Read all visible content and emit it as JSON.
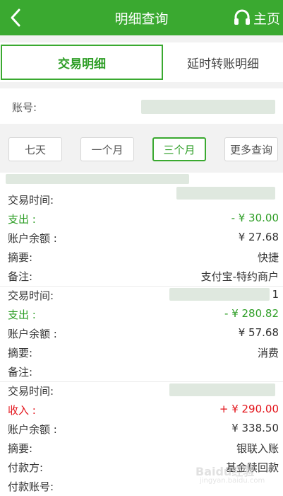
{
  "header": {
    "title": "明细查询",
    "home_label": "主页"
  },
  "tabs": [
    {
      "label": "交易明细",
      "active": true
    },
    {
      "label": "延时转账明细",
      "active": false
    }
  ],
  "account": {
    "label": "账号:"
  },
  "filters": [
    {
      "label": "七天",
      "active": false
    },
    {
      "label": "一个月",
      "active": false
    },
    {
      "label": "三个月",
      "active": true
    },
    {
      "label": "更多查询",
      "active": false
    }
  ],
  "records": [
    {
      "time_label": "交易时间:",
      "type_label": "支出 :",
      "amount": "- ¥ 30.00",
      "balance_label": "账户余额 :",
      "balance": "¥ 27.68",
      "summary_label": "摘要:",
      "summary": "快捷",
      "note_label": "备注:",
      "note": "支付宝-特约商户"
    },
    {
      "time_label": "交易时间:",
      "time_partial": "1",
      "type_label": "支出 :",
      "amount": "- ¥ 280.82",
      "balance_label": "账户余额 :",
      "balance": "¥ 57.68",
      "summary_label": "摘要:",
      "summary": "消费",
      "note_label": "备注:"
    },
    {
      "time_label": "交易时间:",
      "type_label": "收入 :",
      "amount": "+ ¥ 290.00",
      "balance_label": "账户余额 :",
      "balance": "¥ 338.50",
      "summary_label": "摘要:",
      "summary": "银联入账",
      "payer_label": "付款方:",
      "payer": "基金赎回款",
      "payer_account_label": "付款账号:"
    }
  ],
  "watermark": {
    "text": "Baidu经验",
    "sub": "jingyan.baidu.com"
  },
  "colors": {
    "brand_green": "#3aa930",
    "expense_green": "#2e9e26",
    "income_red": "#e3141b"
  }
}
